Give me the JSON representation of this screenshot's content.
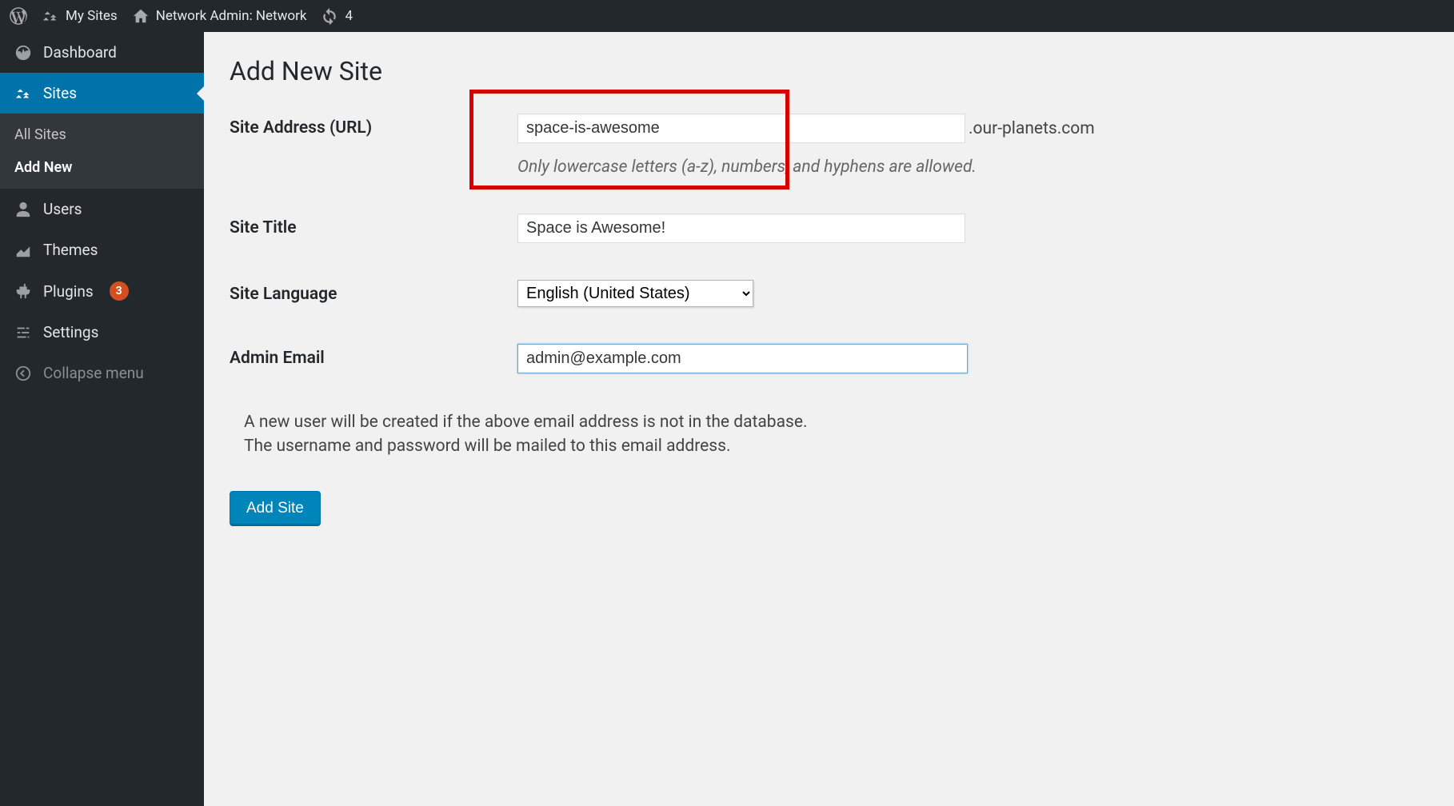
{
  "adminbar": {
    "my_sites_label": "My Sites",
    "network_admin_label": "Network Admin: Network",
    "refresh_count": "4"
  },
  "sidebar": {
    "dashboard_label": "Dashboard",
    "sites_label": "Sites",
    "submenu": {
      "all_sites": "All Sites",
      "add_new": "Add New"
    },
    "users_label": "Users",
    "themes_label": "Themes",
    "plugins_label": "Plugins",
    "plugins_count": "3",
    "settings_label": "Settings",
    "collapse_label": "Collapse menu"
  },
  "main": {
    "page_title": "Add New Site",
    "site_address_label": "Site Address (URL)",
    "site_address_value": "space-is-awesome",
    "domain_suffix": ".our-planets.com",
    "site_address_help": "Only lowercase letters (a-z), numbers, and hyphens are allowed.",
    "site_title_label": "Site Title",
    "site_title_value": "Space is Awesome!",
    "site_language_label": "Site Language",
    "site_language_value": "English (United States)",
    "admin_email_label": "Admin Email",
    "admin_email_value": "admin@example.com",
    "notice_line1": "A new user will be created if the above email address is not in the database.",
    "notice_line2": "The username and password will be mailed to this email address.",
    "submit_label": "Add Site"
  }
}
